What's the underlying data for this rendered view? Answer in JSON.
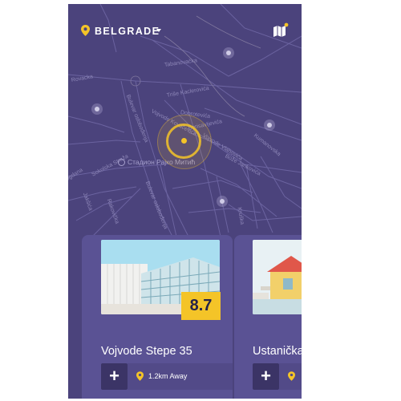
{
  "header": {
    "city": "BELGRADE",
    "city_pin_icon": "location-pin-icon",
    "map_button_icon": "map-icon",
    "accent_color": "#f4c428"
  },
  "map": {
    "streets": [
      "Tabanovačka",
      "Triše Kaclerovića",
      "Rovacka",
      "Bulevar oslobođenja",
      "Vojvode Kovačevića",
      "Dobrotevića",
      "Borisavljevića",
      "Vojvode Vlahovića",
      "Kumanovska",
      "Bože Jankovića",
      "Bogdana",
      "Jakšića",
      "Rakovička",
      "Sokolska Straža",
      "Bulevar oslobođenja",
      "Kruška"
    ],
    "landmark": "Стадион Рајко Митић"
  },
  "cards": [
    {
      "title": "Vojvode Stepe 35",
      "rating": "8.7",
      "distance": "1.2km Away",
      "add_label": "+"
    },
    {
      "title": "Ustanička",
      "add_label": "+"
    }
  ]
}
